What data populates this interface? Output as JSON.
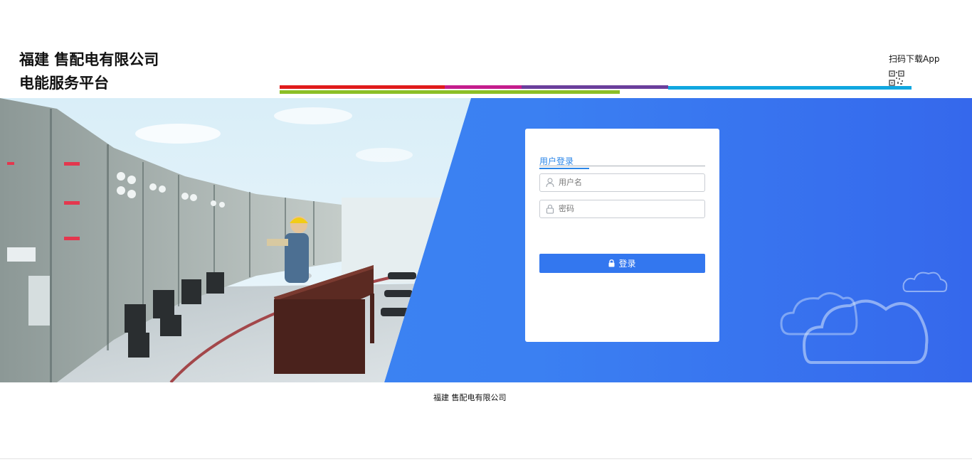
{
  "header": {
    "company_line1": "福建     售配电有限公司",
    "company_line2": "电能服务平台",
    "app_download": "扫码下载App",
    "stripe_colors": [
      "#e01b1b",
      "#c41d8c",
      "#6a3e9c",
      "#11a7e0",
      "#8cbf26"
    ]
  },
  "banner": {
    "photo_icon": "power-control-room-photo",
    "cloud_icon": "cloud-icon"
  },
  "login": {
    "tab_label": "用户登录",
    "username_placeholder": "用户名",
    "password_placeholder": "密码",
    "submit_label": "登录",
    "user_icon": "user-icon",
    "lock_icon": "lock-icon",
    "accent_color": "#3377ef"
  },
  "footer": {
    "company": "福建     售配电有限公司"
  }
}
